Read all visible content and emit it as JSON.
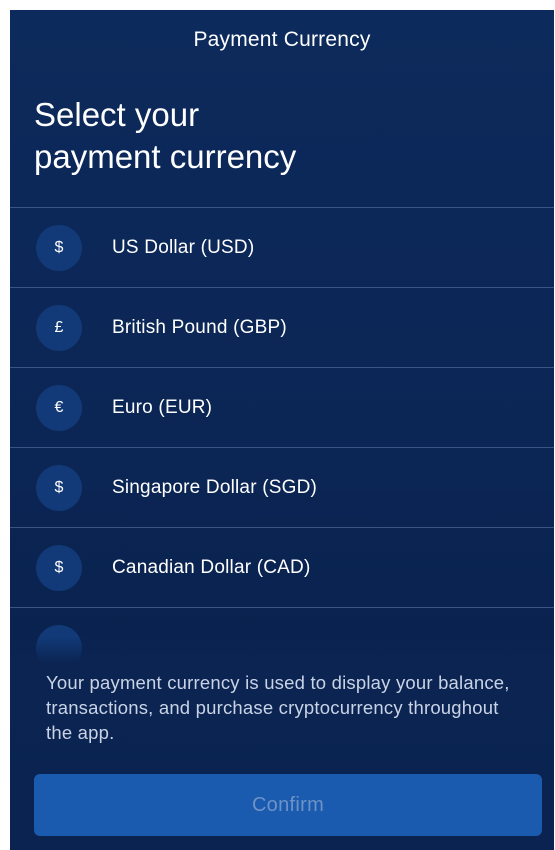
{
  "header": {
    "title": "Payment Currency"
  },
  "heading": {
    "line1": "Select your",
    "line2": "payment currency"
  },
  "currencies": [
    {
      "symbol": "$",
      "label": "US Dollar (USD)"
    },
    {
      "symbol": "£",
      "label": "British Pound (GBP)"
    },
    {
      "symbol": "€",
      "label": "Euro (EUR)"
    },
    {
      "symbol": "$",
      "label": "Singapore Dollar (SGD)"
    },
    {
      "symbol": "$",
      "label": "Canadian Dollar (CAD)"
    }
  ],
  "info": {
    "text": "Your payment currency is used to display your balance, transactions, and purchase cryptocurrency throughout the app."
  },
  "actions": {
    "confirm_label": "Confirm"
  },
  "colors": {
    "background": "#0b2554",
    "symbol_circle": "#123a78",
    "divider": "#3a5585",
    "confirm_button": "#1a5bb0",
    "confirm_text_disabled": "#6d92c6"
  }
}
